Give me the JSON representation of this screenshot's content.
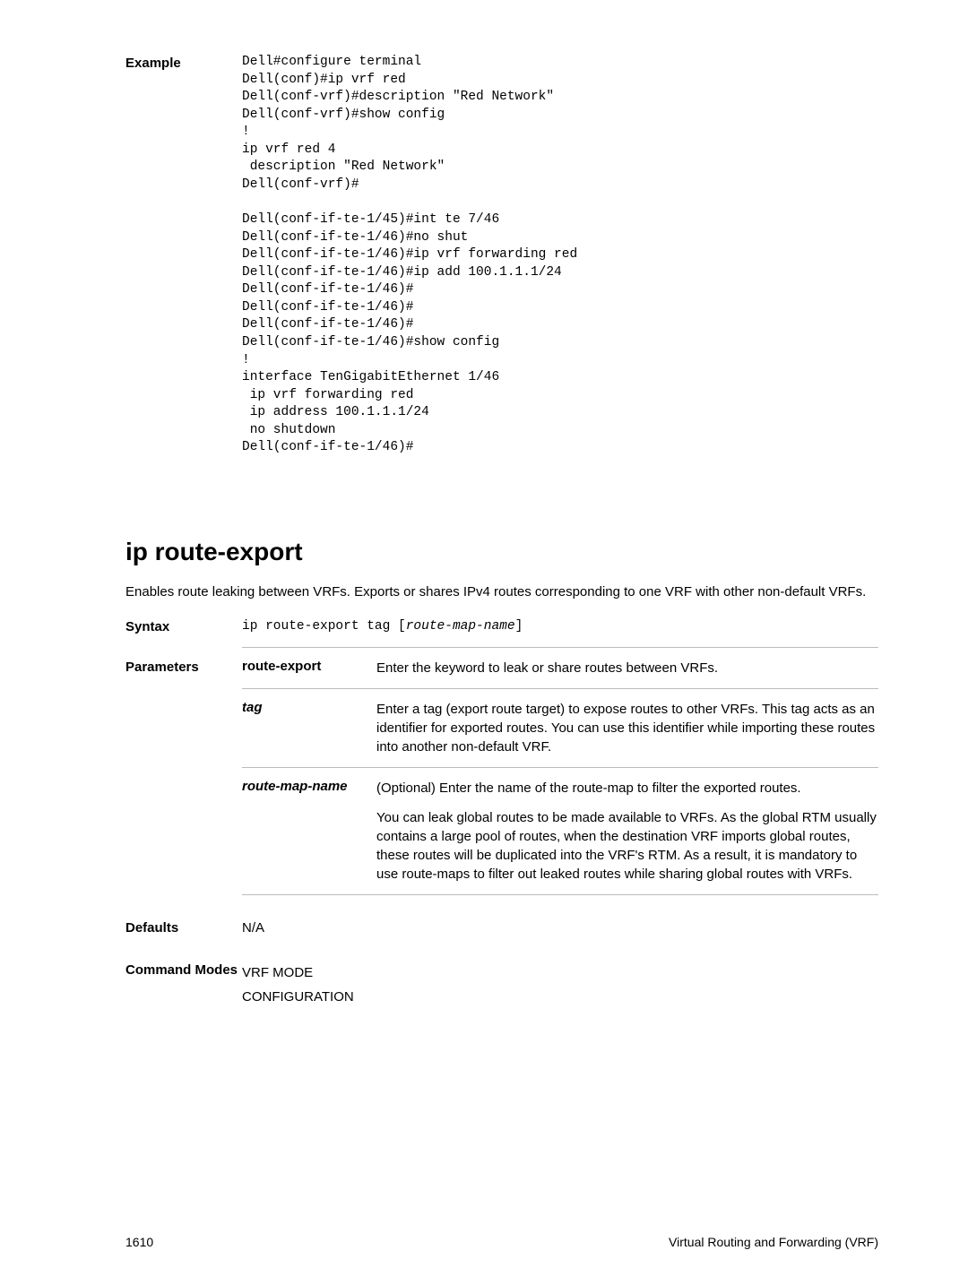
{
  "example": {
    "label": "Example",
    "code": "Dell#configure terminal\nDell(conf)#ip vrf red\nDell(conf-vrf)#description \"Red Network\"\nDell(conf-vrf)#show config\n!\nip vrf red 4\n description \"Red Network\"\nDell(conf-vrf)#\n\nDell(conf-if-te-1/45)#int te 7/46\nDell(conf-if-te-1/46)#no shut\nDell(conf-if-te-1/46)#ip vrf forwarding red\nDell(conf-if-te-1/46)#ip add 100.1.1.1/24\nDell(conf-if-te-1/46)#\nDell(conf-if-te-1/46)#\nDell(conf-if-te-1/46)#\nDell(conf-if-te-1/46)#show config\n!\ninterface TenGigabitEthernet 1/46\n ip vrf forwarding red\n ip address 100.1.1.1/24\n no shutdown\nDell(conf-if-te-1/46)#"
  },
  "section": {
    "title": "ip route-export",
    "desc": "Enables route leaking between VRFs. Exports or shares IPv4 routes corresponding to one VRF with other non-default VRFs."
  },
  "syntax": {
    "label": "Syntax",
    "prefix": "ip route-export tag [",
    "arg": "route-map-name",
    "suffix": "]"
  },
  "parameters": {
    "label": "Parameters",
    "rows": [
      {
        "name": "route-export",
        "name_style": "bold",
        "desc": "Enter the keyword to leak or share routes between VRFs."
      },
      {
        "name": "tag",
        "name_style": "bolditalic",
        "desc": "Enter a tag (export route target) to expose routes to other VRFs. This tag acts as an identifier for exported routes. You can use this identifier while importing these routes into another non-default VRF."
      },
      {
        "name": "route-map-name",
        "name_style": "bolditalic",
        "desc1": "(Optional) Enter the name of the route-map to filter the exported routes.",
        "desc2": "You can leak global routes to be made available to VRFs. As the global RTM usually contains a large pool of routes, when the destination VRF imports global routes, these routes will be duplicated into the VRF's RTM. As a result, it is mandatory to use route-maps to filter out leaked routes while sharing global routes with VRFs."
      }
    ]
  },
  "defaults": {
    "label": "Defaults",
    "value": "N/A"
  },
  "cmdmodes": {
    "label": "Command Modes",
    "line1": "VRF MODE",
    "line2": "CONFIGURATION"
  },
  "footer": {
    "page": "1610",
    "title": "Virtual Routing and Forwarding (VRF)"
  }
}
